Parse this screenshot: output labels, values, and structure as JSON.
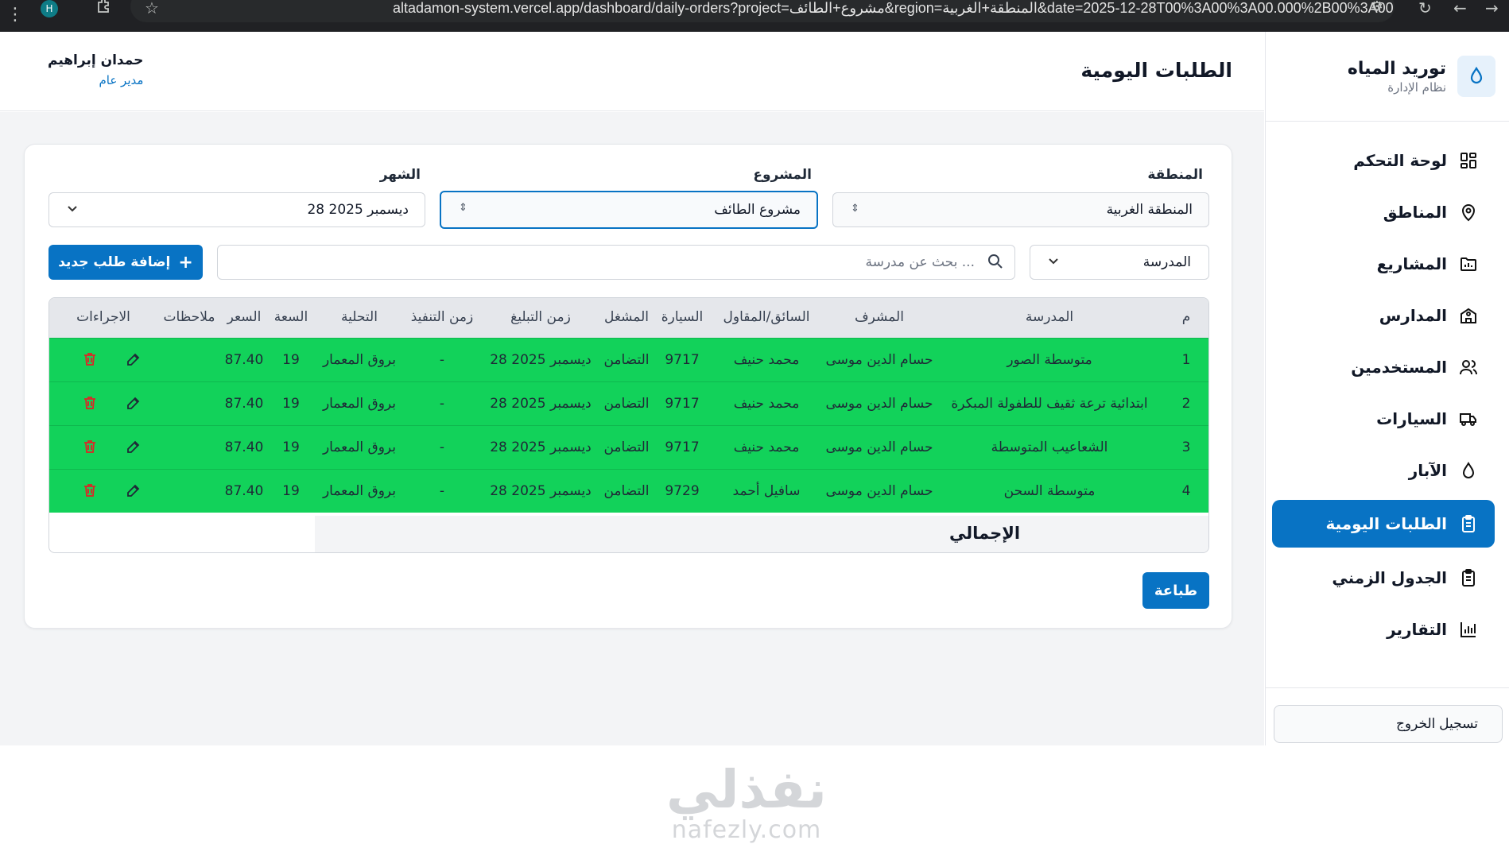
{
  "browser": {
    "url": "altadamon-system.vercel.app/dashboard/daily-orders?project=مشروع+الطائف&region=المنطقة+الغربية&date=2025-12-28T00%3A00%3A00.000%2B00%3A00",
    "profile_initial": "H"
  },
  "sidebar": {
    "app_name": "توريد المياه",
    "app_subtitle": "نظام الإدارة",
    "items": [
      {
        "label": "لوحة التحكم",
        "icon": "grid-icon",
        "active": false
      },
      {
        "label": "المناطق",
        "icon": "map-pin-icon",
        "active": false
      },
      {
        "label": "المشاريع",
        "icon": "folder-chart-icon",
        "active": false
      },
      {
        "label": "المدارس",
        "icon": "school-icon",
        "active": false
      },
      {
        "label": "المستخدمين",
        "icon": "users-icon",
        "active": false
      },
      {
        "label": "السيارات",
        "icon": "truck-icon",
        "active": false
      },
      {
        "label": "الآبار",
        "icon": "droplet-icon",
        "active": false
      },
      {
        "label": "الطلبات اليومية",
        "icon": "clipboard-icon",
        "active": true
      },
      {
        "label": "الجدول الزمني",
        "icon": "clipboard-list-icon",
        "active": false
      },
      {
        "label": "التقارير",
        "icon": "bar-chart-icon",
        "active": false
      }
    ],
    "logout_label": "تسجيل الخروج"
  },
  "header": {
    "page_title": "الطلبات اليومية",
    "user_name": "حمدان إبراهيم",
    "user_role": "مدير عام"
  },
  "filters": {
    "region_label": "المنطقة",
    "region_value": "المنطقة الغربية",
    "project_label": "المشروع",
    "project_value": "مشروع الطائف",
    "month_label": "الشهر",
    "month_value": "28 ديسمبر 2025",
    "school_select": "المدرسة",
    "search_placeholder": "بحث عن مدرسة ...",
    "add_button": "إضافة طلب جديد"
  },
  "table": {
    "columns": [
      "م",
      "المدرسة",
      "المشرف",
      "السائق/المقاول",
      "السيارة",
      "المشغل",
      "زمن التبليغ",
      "زمن التنفيذ",
      "التحلية",
      "السعة",
      "السعر",
      "ملاحظات",
      "الاجراءات"
    ],
    "rows": [
      {
        "no": "1",
        "school": "متوسطة الصور",
        "supervisor": "حسام الدين موسى",
        "driver": "محمد حنيف",
        "car": "9717",
        "operator": "التضامن",
        "notify_time": "28 ديسمبر 2025",
        "exec_time": "-",
        "desal": "بروق المعمار",
        "capacity": "19",
        "price": "87.40",
        "notes": ""
      },
      {
        "no": "2",
        "school": "ابتدائية ترعة ثقيف للطفولة المبكرة",
        "supervisor": "حسام الدين موسى",
        "driver": "محمد حنيف",
        "car": "9717",
        "operator": "التضامن",
        "notify_time": "28 ديسمبر 2025",
        "exec_time": "-",
        "desal": "بروق المعمار",
        "capacity": "19",
        "price": "87.40",
        "notes": ""
      },
      {
        "no": "3",
        "school": "الشعاعيب المتوسطة",
        "supervisor": "حسام الدين موسى",
        "driver": "محمد حنيف",
        "car": "9717",
        "operator": "التضامن",
        "notify_time": "28 ديسمبر 2025",
        "exec_time": "-",
        "desal": "بروق المعمار",
        "capacity": "19",
        "price": "87.40",
        "notes": ""
      },
      {
        "no": "4",
        "school": "متوسطة السحن",
        "supervisor": "حسام الدين موسى",
        "driver": "سافيل أحمد",
        "car": "9729",
        "operator": "التضامن",
        "notify_time": "28 ديسمبر 2025",
        "exec_time": "-",
        "desal": "بروق المعمار",
        "capacity": "19",
        "price": "87.40",
        "notes": ""
      }
    ],
    "total_label": "الإجمالي",
    "row_color": "#12d25a"
  },
  "print_button": "طباعة",
  "watermark": {
    "ar": "نفذلي",
    "en": "nafezly.com"
  },
  "colors": {
    "accent": "#0873c4",
    "success_row": "#12d25a"
  }
}
